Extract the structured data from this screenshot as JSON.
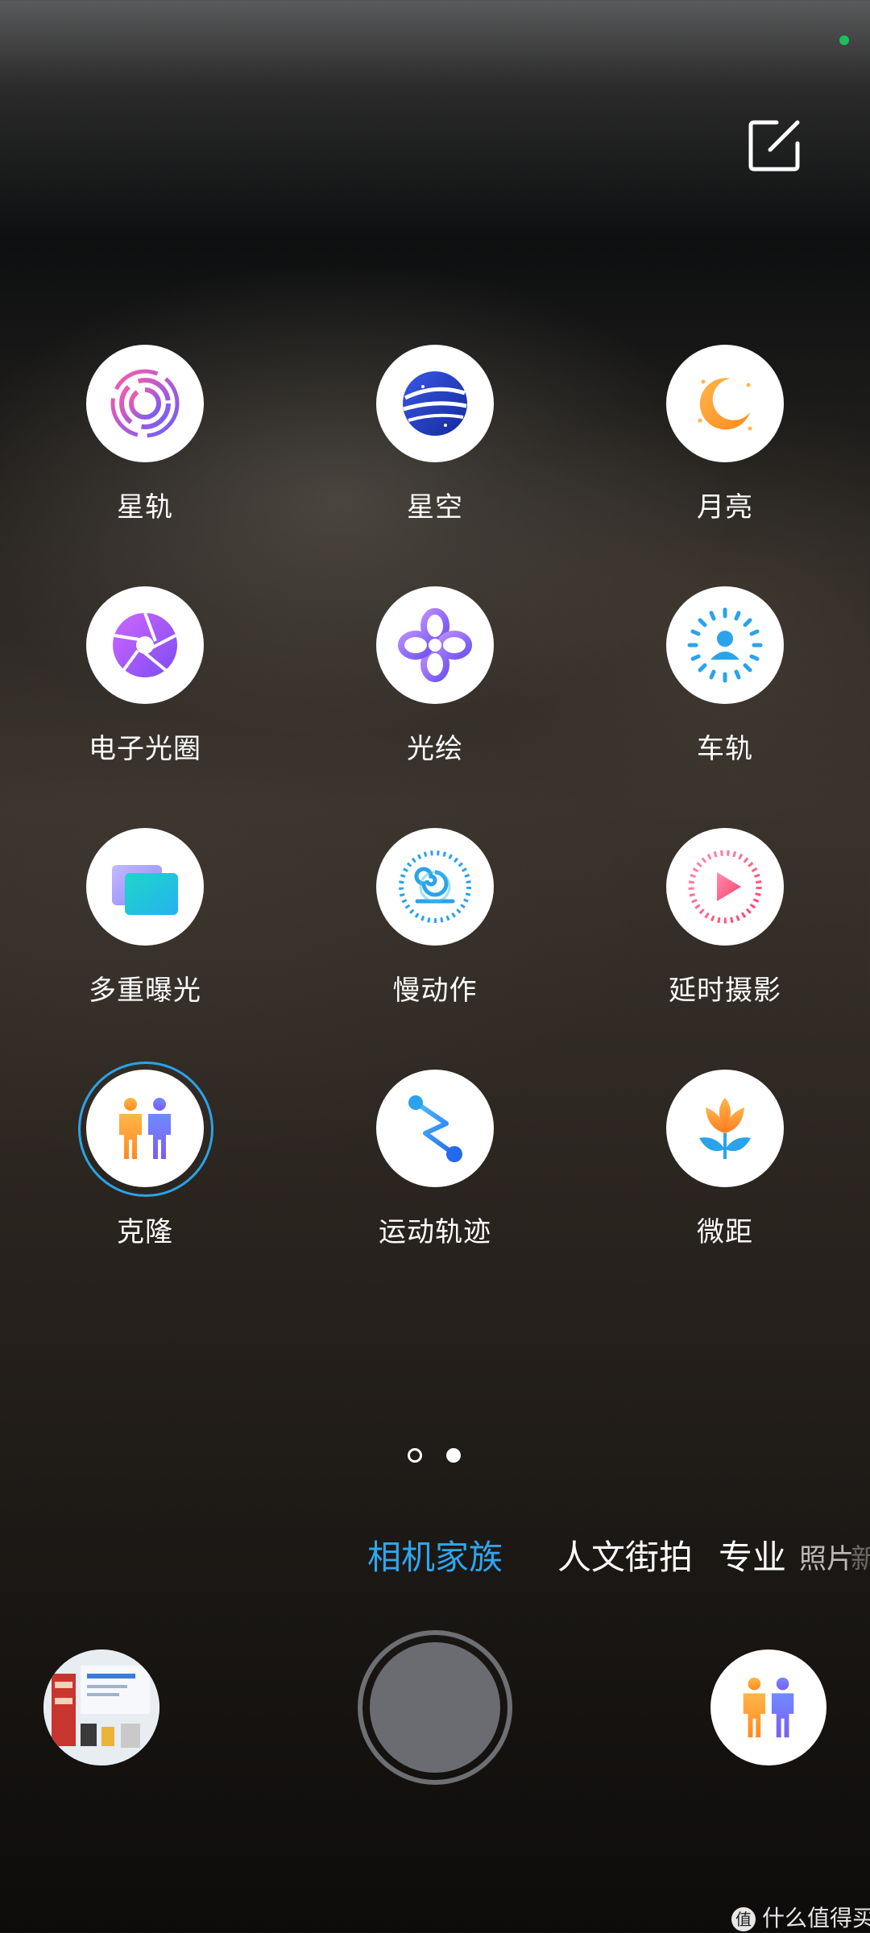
{
  "modes_grid": [
    {
      "label": "星轨",
      "icon": "star-trails-icon"
    },
    {
      "label": "星空",
      "icon": "starry-sky-icon"
    },
    {
      "label": "月亮",
      "icon": "moon-icon"
    },
    {
      "label": "电子光圈",
      "icon": "aperture-icon"
    },
    {
      "label": "光绘",
      "icon": "light-painting-icon"
    },
    {
      "label": "车轨",
      "icon": "car-trails-icon"
    },
    {
      "label": "多重曝光",
      "icon": "multi-exposure-icon"
    },
    {
      "label": "慢动作",
      "icon": "slow-motion-icon"
    },
    {
      "label": "延时摄影",
      "icon": "timelapse-icon"
    },
    {
      "label": "克隆",
      "icon": "clone-icon",
      "selected": true
    },
    {
      "label": "运动轨迹",
      "icon": "motion-track-icon"
    },
    {
      "label": "微距",
      "icon": "macro-icon"
    }
  ],
  "pager": {
    "pages": 2,
    "current": 2
  },
  "mode_tabs": [
    {
      "label": "相机家族",
      "active": true
    },
    {
      "label": "人文街拍"
    },
    {
      "label": "专业"
    },
    {
      "label": "照片"
    },
    {
      "label": "新"
    }
  ],
  "controls": {
    "gallery_icon": "gallery-thumbnail",
    "shutter_icon": "shutter-button",
    "current_mode_icon": "clone-icon"
  },
  "watermark": {
    "text": "什么值得买",
    "icon_glyph": "值"
  },
  "colors": {
    "accent": "#2ea6ef",
    "status_dot": "#19c25a",
    "shutter": "#6b6c72"
  }
}
